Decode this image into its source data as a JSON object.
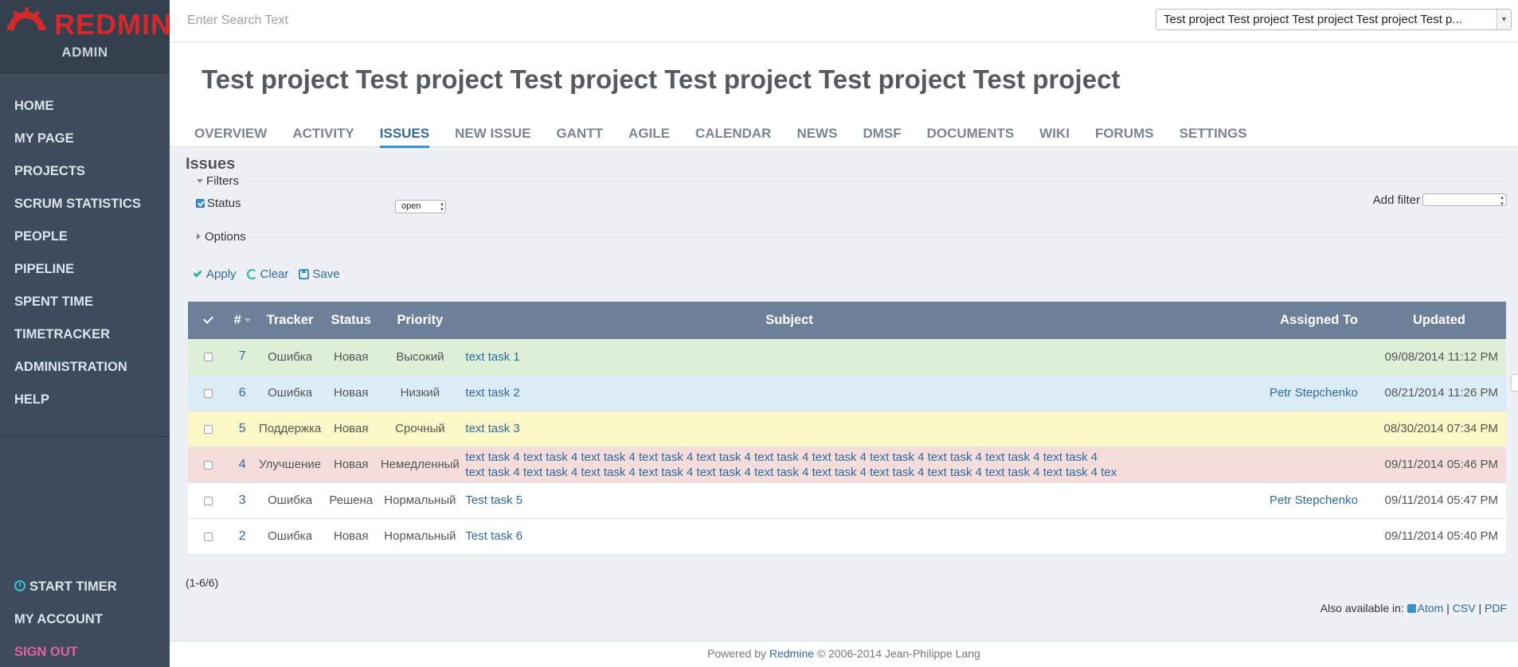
{
  "brand": {
    "logo_text": "REDMINE",
    "subtitle": "ADMIN",
    "logo_color": "#d3292b"
  },
  "sidebar": {
    "main_items": [
      {
        "label": "HOME"
      },
      {
        "label": "MY PAGE"
      },
      {
        "label": "PROJECTS"
      },
      {
        "label": "SCRUM STATISTICS"
      },
      {
        "label": "PEOPLE"
      },
      {
        "label": "PIPELINE"
      },
      {
        "label": "SPENT TIME"
      },
      {
        "label": "TIMETRACKER"
      },
      {
        "label": "ADMINISTRATION"
      },
      {
        "label": "HELP"
      }
    ],
    "bottom_items": [
      {
        "label": "START TIMER",
        "icon": "clock-icon"
      },
      {
        "label": "MY ACCOUNT"
      },
      {
        "label": "SIGN OUT"
      }
    ]
  },
  "topbar": {
    "search_placeholder": "Enter Search Text",
    "project_selected": "Test project Test project Test project Test project Test p..."
  },
  "header": {
    "title": "Test project Test project Test project Test project Test project Test project",
    "tabs": [
      {
        "label": "OVERVIEW"
      },
      {
        "label": "ACTIVITY"
      },
      {
        "label": "ISSUES",
        "active": true
      },
      {
        "label": "NEW ISSUE"
      },
      {
        "label": "GANTT"
      },
      {
        "label": "AGILE"
      },
      {
        "label": "CALENDAR"
      },
      {
        "label": "NEWS"
      },
      {
        "label": "DMSF"
      },
      {
        "label": "DOCUMENTS"
      },
      {
        "label": "WIKI"
      },
      {
        "label": "FORUMS"
      },
      {
        "label": "SETTINGS"
      }
    ]
  },
  "issues": {
    "heading": "Issues",
    "filters_label": "Filters",
    "status_label": "Status",
    "status_value": "open",
    "add_filter_label": "Add filter",
    "options_label": "Options",
    "actions": {
      "apply": "Apply",
      "clear": "Clear",
      "save": "Save"
    },
    "columns": {
      "check": "✓",
      "id": "#",
      "tracker": "Tracker",
      "status": "Status",
      "priority": "Priority",
      "subject": "Subject",
      "assigned": "Assigned To",
      "updated": "Updated"
    },
    "rows": [
      {
        "id": "7",
        "tracker": "Ошибка",
        "status": "Новая",
        "priority": "Высокий",
        "subject": "text task 1",
        "assigned": "",
        "updated": "09/08/2014 11:12 PM",
        "color": "#ddefd7"
      },
      {
        "id": "6",
        "tracker": "Ошибка",
        "status": "Новая",
        "priority": "Низкий",
        "subject": "text task 2",
        "assigned": "Petr Stepchenko",
        "updated": "08/21/2014 11:26 PM",
        "color": "#dcecf6"
      },
      {
        "id": "5",
        "tracker": "Поддержка",
        "status": "Новая",
        "priority": "Срочный",
        "subject": "text task 3",
        "assigned": "",
        "updated": "08/30/2014 07:34 PM",
        "color": "#fcf7c7"
      },
      {
        "id": "4",
        "tracker": "Улучшение",
        "status": "Новая",
        "priority": "Немедленный",
        "subject": "text task 4 text task 4 text task 4 text task 4 text task 4 text task 4 text task 4 text task 4 text task 4 text task 4 text task 4 text task 4 text task 4 text task 4 text task 4 text task 4 text task 4 text task 4 text task 4 text task 4 text task 4 text task 4 tex",
        "assigned": "",
        "updated": "09/11/2014 05:46 PM",
        "color": "#f5dddc"
      },
      {
        "id": "3",
        "tracker": "Ошибка",
        "status": "Решена",
        "priority": "Нормальный",
        "subject": "Test task 5",
        "assigned": "Petr Stepchenko",
        "updated": "09/11/2014 05:47 PM",
        "color": "#ffffff"
      },
      {
        "id": "2",
        "tracker": "Ошибка",
        "status": "Новая",
        "priority": "Нормальный",
        "subject": "Test task 6",
        "assigned": "",
        "updated": "09/11/2014 05:40 PM",
        "color": "#ffffff"
      }
    ],
    "count": "(1-6/6)",
    "also_available": "Also available in:",
    "formats": [
      "Atom",
      "CSV",
      "PDF"
    ]
  },
  "footer": {
    "prefix": "Powered by",
    "link": "Redmine",
    "suffix": "© 2006-2014 Jean-Philippe Lang"
  }
}
